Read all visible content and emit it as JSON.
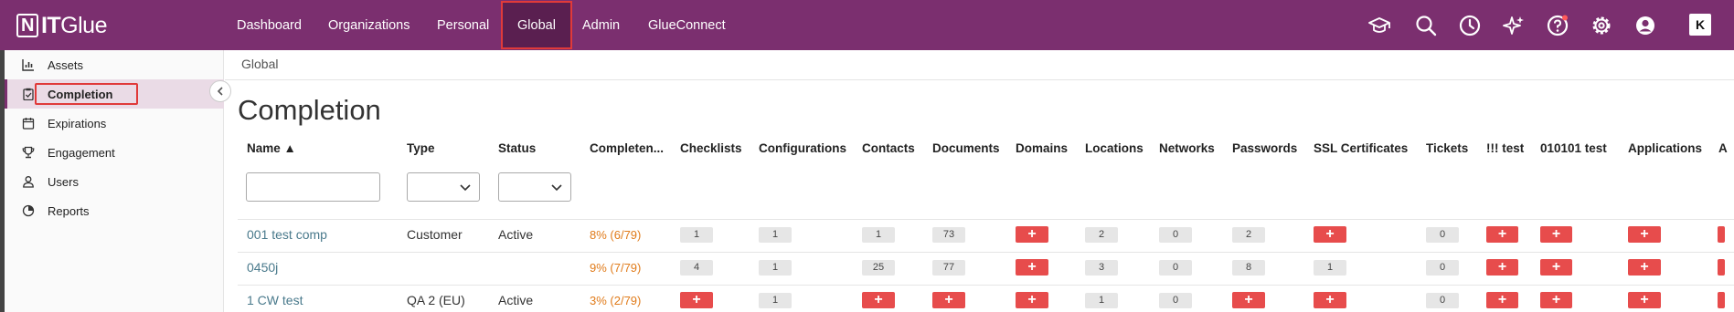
{
  "nav": {
    "logo_mark": "N",
    "logo_it": "IT",
    "logo_glue": "Glue",
    "items": [
      "Dashboard",
      "Organizations",
      "Personal",
      "Global",
      "Admin",
      "GlueConnect"
    ],
    "active": "Global",
    "icons": [
      "graduation-cap-icon",
      "search-icon",
      "clock-icon",
      "sparkle-icon",
      "help-icon",
      "gear-icon",
      "user-icon"
    ],
    "brand_badge": "K"
  },
  "sidebar": {
    "items": [
      {
        "label": "Assets",
        "icon": "chart-icon"
      },
      {
        "label": "Completion",
        "icon": "clipboard-icon",
        "active": true
      },
      {
        "label": "Expirations",
        "icon": "calendar-icon"
      },
      {
        "label": "Engagement",
        "icon": "trophy-icon"
      },
      {
        "label": "Users",
        "icon": "user-icon"
      },
      {
        "label": "Reports",
        "icon": "report-icon"
      }
    ]
  },
  "breadcrumb": "Global",
  "page_title": "Completion",
  "table": {
    "columns": [
      "Name ▲",
      "Type",
      "Status",
      "Completen...",
      "Checklists",
      "Configurations",
      "Contacts",
      "Documents",
      "Domains",
      "Locations",
      "Networks",
      "Passwords",
      "SSL Certificates",
      "Tickets",
      "!!! test",
      "010101 test",
      "Applications",
      "A"
    ],
    "rows": [
      {
        "name": "001 test comp",
        "type": "Customer",
        "status": "Active",
        "completeness": "8% (6/79)",
        "cells": [
          "1",
          "1",
          "1",
          "73",
          "+",
          "2",
          "0",
          "2",
          "+",
          "0",
          "+",
          "+",
          "+",
          "+"
        ]
      },
      {
        "name": "0450j",
        "type": "",
        "status": "",
        "completeness": "9% (7/79)",
        "cells": [
          "4",
          "1",
          "25",
          "77",
          "+",
          "3",
          "0",
          "8",
          "1",
          "0",
          "+",
          "+",
          "+",
          "+"
        ]
      },
      {
        "name": "1 CW test",
        "type": "QA 2 (EU)",
        "status": "Active",
        "completeness": "3% (2/79)",
        "cells": [
          "+",
          "1",
          "+",
          "+",
          "+",
          "1",
          "0",
          "+",
          "+",
          "0",
          "+",
          "+",
          "+",
          "+"
        ]
      }
    ]
  },
  "colors": {
    "nav_bg": "#7b2f6f",
    "accent_red": "#e74c4c",
    "link": "#4a7a8c",
    "percent": "#e07b1a",
    "highlight": "#e03a3a"
  }
}
